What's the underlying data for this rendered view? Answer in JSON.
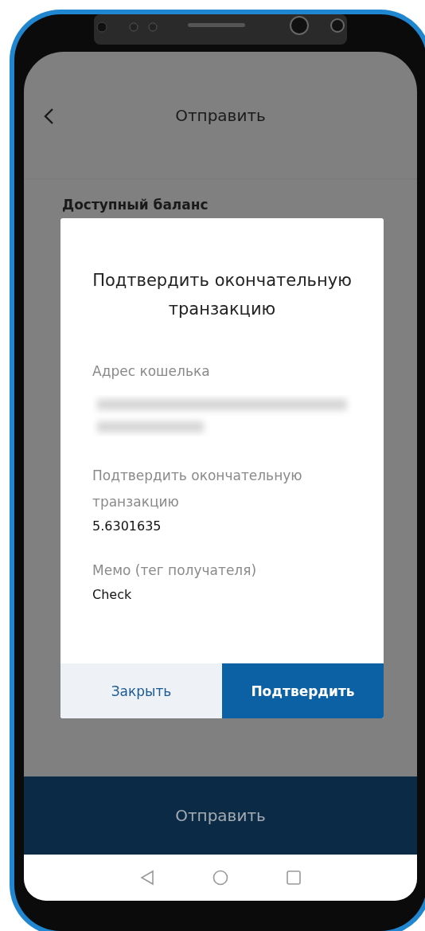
{
  "header": {
    "title": "Отправить"
  },
  "balance_label": "Доступный баланс",
  "dialog": {
    "title": "Подтвердить окончательную транзакцию",
    "fields": [
      {
        "kind": "blurred",
        "label": "Адрес кошелька"
      },
      {
        "kind": "text",
        "label": "Подтвердить окончательную транзакцию",
        "value": "5.6301635"
      },
      {
        "kind": "text",
        "label": "Мемо (тег получателя)",
        "value": "Check"
      }
    ],
    "buttons": [
      {
        "kind": "secondary",
        "label": "Закрыть"
      },
      {
        "kind": "primary",
        "label": "Подтвердить"
      }
    ]
  },
  "send_button": "Отправить"
}
